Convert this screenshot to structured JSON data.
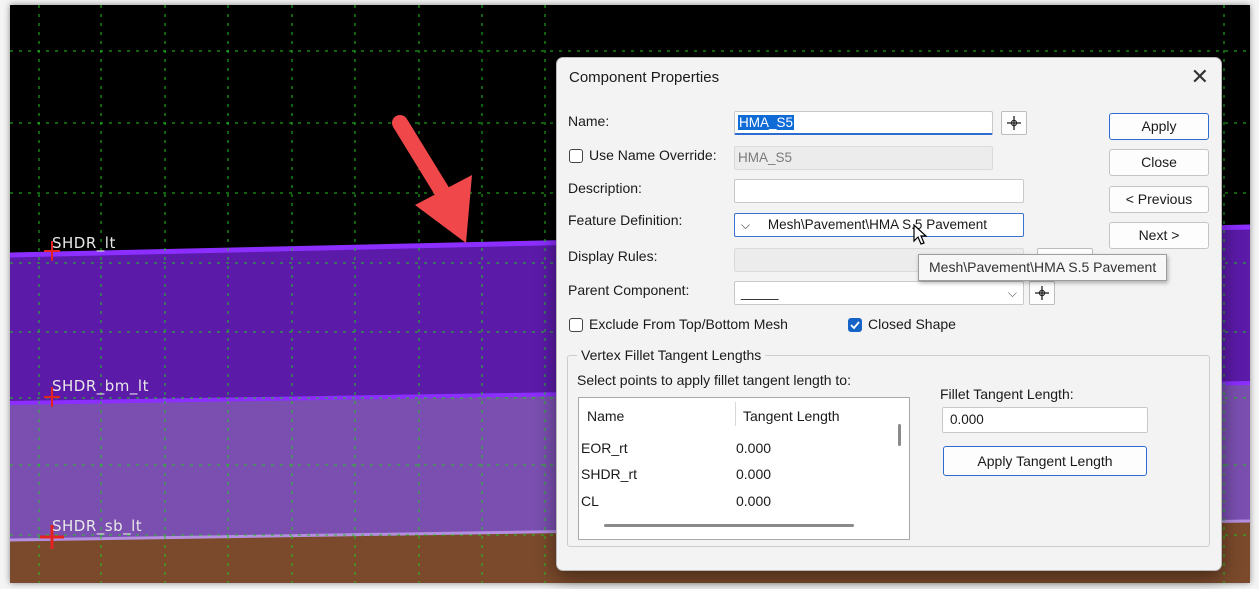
{
  "viewport": {
    "labels": [
      "SHDR_lt",
      "SHDR_bm_lt",
      "SHDR_sb_lt"
    ],
    "colors": {
      "background": "#000000",
      "grid": "#22c41f",
      "pavement": "#5b1aa8",
      "pavement_line": "#8b2eff",
      "base": "#7a4fb0",
      "subbase": "#7b4a2c",
      "arrow": "#f0484a",
      "point_marker": "#e52222"
    }
  },
  "dialog": {
    "title": "Component Properties",
    "close_icon": "close-icon",
    "name_label": "Name:",
    "name_value": "HMA_S5",
    "use_name_override_label": "Use Name Override:",
    "use_name_override_checked": false,
    "name_override_value": "HMA_S5",
    "description_label": "Description:",
    "description_value": "",
    "feature_definition_label": "Feature Definition:",
    "feature_definition_value": "Mesh\\Pavement\\HMA S.5 Pavement",
    "display_rules_label": "Display Rules:",
    "display_rules_value": "",
    "parent_component_label": "Parent Component:",
    "parent_component_value": "_____",
    "exclude_label": "Exclude From Top/Bottom Mesh",
    "exclude_checked": false,
    "closed_shape_label": "Closed Shape",
    "closed_shape_checked": true,
    "buttons": {
      "apply": "Apply",
      "close": "Close",
      "previous": "< Previous",
      "next": "Next >"
    },
    "vertex_group": {
      "title": "Vertex Fillet Tangent Lengths",
      "instruction": "Select points to apply fillet tangent length to:",
      "columns": [
        "Name",
        "Tangent Length"
      ],
      "rows": [
        {
          "name": "EOR_rt",
          "length": "0.000"
        },
        {
          "name": "SHDR_rt",
          "length": "0.000"
        },
        {
          "name": "CL",
          "length": "0.000"
        }
      ],
      "fillet_label": "Fillet Tangent Length:",
      "fillet_value": "0.000",
      "apply_tangent_label": "Apply Tangent Length"
    },
    "tooltip": "Mesh\\Pavement\\HMA S.5 Pavement"
  }
}
